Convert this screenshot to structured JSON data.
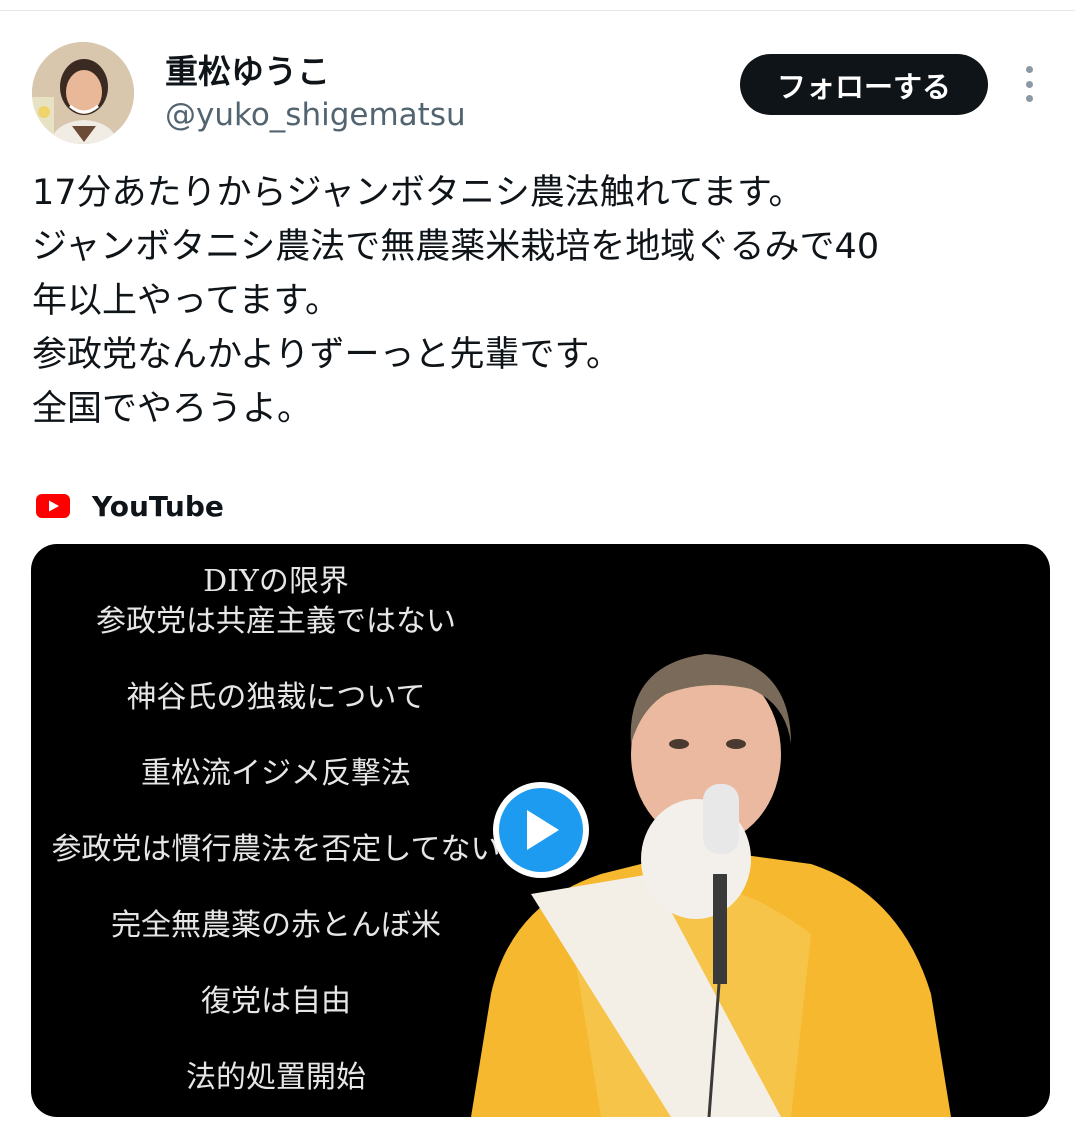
{
  "author": {
    "display_name": "重松ゆうこ",
    "handle": "@yuko_shigematsu",
    "avatar_icon": "profile-photo"
  },
  "actions": {
    "follow_label": "フォローする",
    "more_icon": "more-vertical-icon"
  },
  "tweet": {
    "lines": [
      "17分あたりからジャンボタニシ農法触れてます。",
      "ジャンボタニシ農法で無農薬米栽培を地域ぐるみで40",
      "年以上やってます。",
      "参政党なんかよりずーっと先輩です。",
      "全国でやろうよ。"
    ]
  },
  "card": {
    "source_icon": "youtube-icon",
    "source_label": "YouTube",
    "video_topics": [
      "DIYの限界",
      "参政党は共産主義ではない",
      "神谷氏の独裁について",
      "重松流イジメ反撃法",
      "参政党は慣行農法を否定してない",
      "完全無農薬の赤とんぼ米",
      "復党は自由",
      "法的処置開始"
    ],
    "play_icon": "play-icon"
  },
  "colors": {
    "text": "#0f1419",
    "secondary": "#536471",
    "follow_bg": "#0f1419",
    "play_blue": "#1d9bf0",
    "youtube_red": "#ff0000",
    "jacket": "#f5b82e"
  }
}
